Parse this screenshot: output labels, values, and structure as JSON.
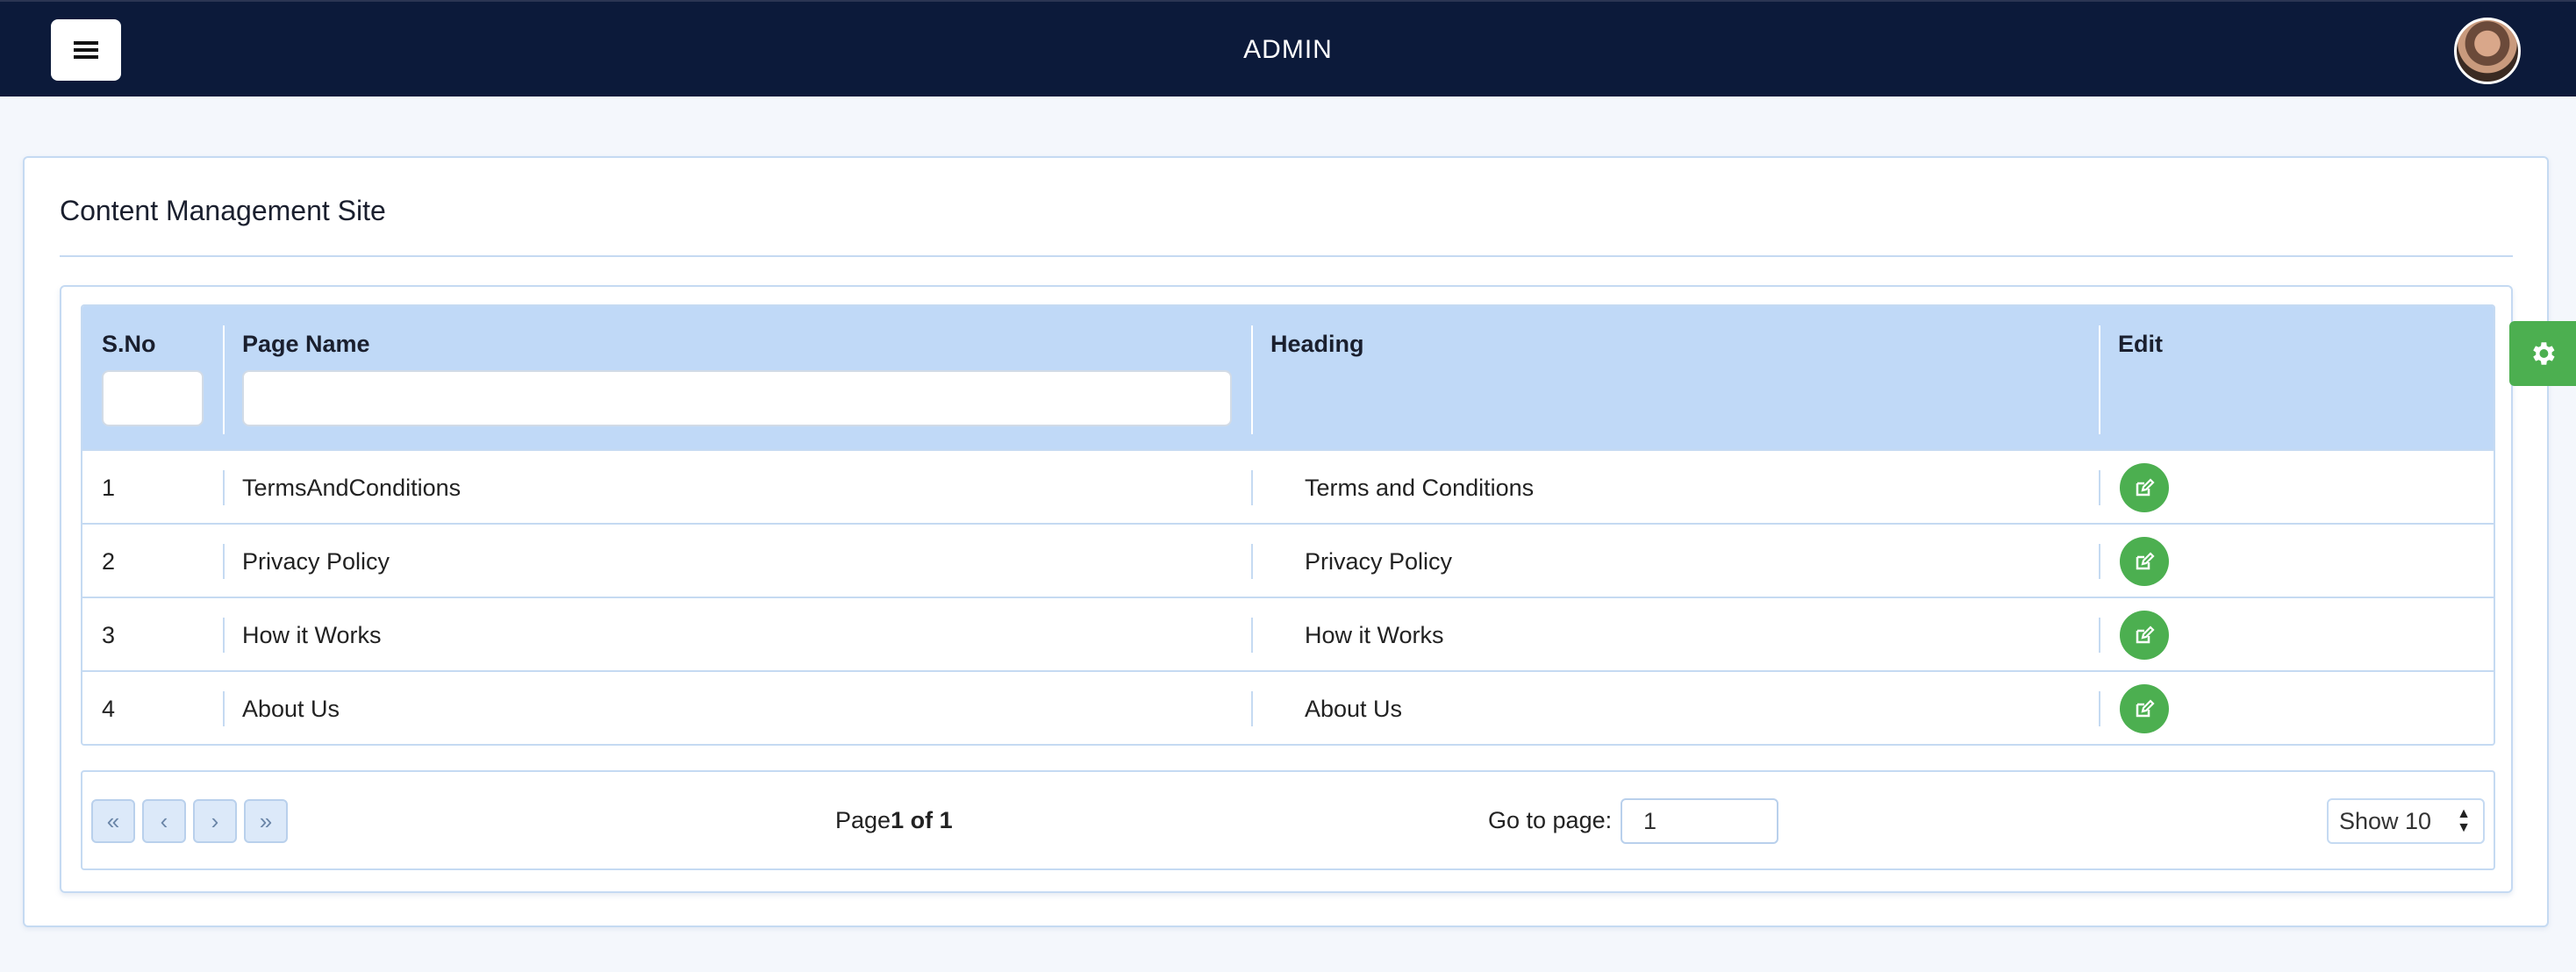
{
  "header": {
    "title": "ADMIN",
    "menu_icon": "hamburger-icon",
    "avatar_icon": "user-avatar"
  },
  "card": {
    "title": "Content Management Site"
  },
  "table": {
    "columns": [
      "S.No",
      "Page Name",
      "Heading",
      "Edit"
    ],
    "filters": {
      "sno": "",
      "page_name": ""
    },
    "rows": [
      {
        "sno": "1",
        "page_name": "TermsAndConditions",
        "heading": "Terms and Conditions"
      },
      {
        "sno": "2",
        "page_name": "Privacy Policy",
        "heading": "Privacy Policy"
      },
      {
        "sno": "3",
        "page_name": "How it Works",
        "heading": "How it Works"
      },
      {
        "sno": "4",
        "page_name": "About Us",
        "heading": "About Us"
      }
    ]
  },
  "pagination": {
    "first_glyph": "«",
    "prev_glyph": "‹",
    "next_glyph": "›",
    "last_glyph": "»",
    "page_prefix": "Page",
    "page_status": "1 of 1",
    "goto_label": "Go to page:",
    "goto_value": "1",
    "show_label": "Show 10"
  },
  "colors": {
    "topbar": "#0c1a3a",
    "accent_green": "#4caf50",
    "table_header": "#c0d9f7",
    "border": "#c5daf2"
  },
  "settings_tab": {
    "icon": "gear-icon"
  }
}
